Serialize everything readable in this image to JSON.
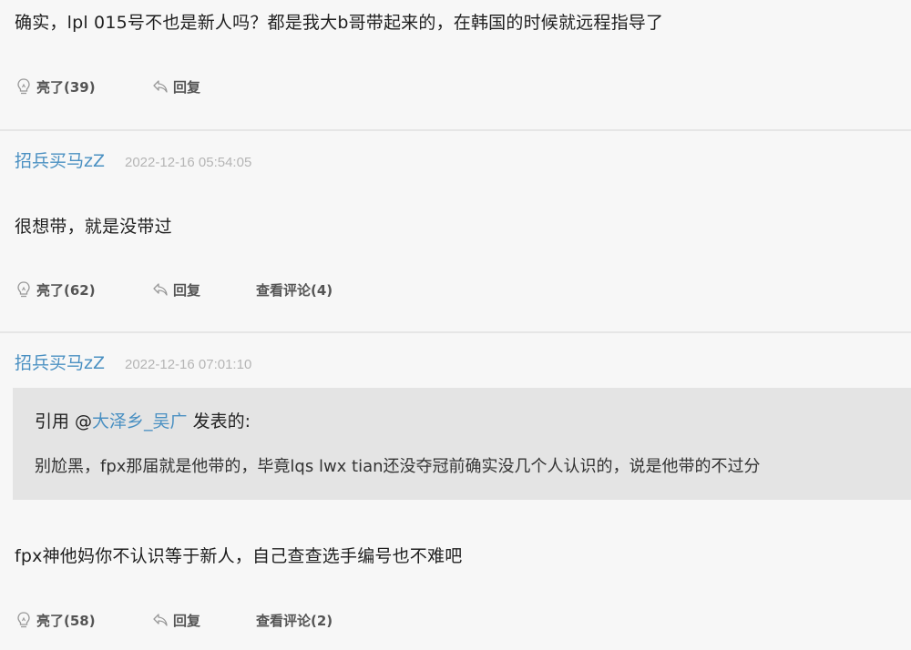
{
  "posts": [
    {
      "text": "确实，lpl 015号不也是新人吗？都是我大b哥带起来的，在韩国的时候就远程指导了",
      "like_label": "亮了(39)",
      "reply_label": "回复"
    },
    {
      "username": "招兵买马zZ",
      "timestamp": "2022-12-16 05:54:05",
      "text": "很想带，就是没带过",
      "like_label": "亮了(62)",
      "reply_label": "回复",
      "comments_label": "查看评论(4)"
    },
    {
      "username": "招兵买马zZ",
      "timestamp": "2022-12-16 07:01:10",
      "quote": {
        "prefix": "引用 @",
        "user": "大泽乡_吴广",
        "suffix": " 发表的:",
        "text": "别尬黑，fpx那届就是他带的，毕竟lqs lwx tian还没夺冠前确实没几个人认识的，说是他带的不过分"
      },
      "text": "fpx神他妈你不认识等于新人，自己查查选手编号也不难吧",
      "like_label": "亮了(58)",
      "reply_label": "回复",
      "comments_label": "查看评论(2)"
    }
  ],
  "icons": {
    "like": "lightbulb-icon",
    "reply": "reply-arrow-icon"
  },
  "colors": {
    "username": "#4a90c2",
    "timestamp": "#b5b5b5",
    "quote_bg": "#e4e4e4",
    "background": "#f7f7f7"
  }
}
